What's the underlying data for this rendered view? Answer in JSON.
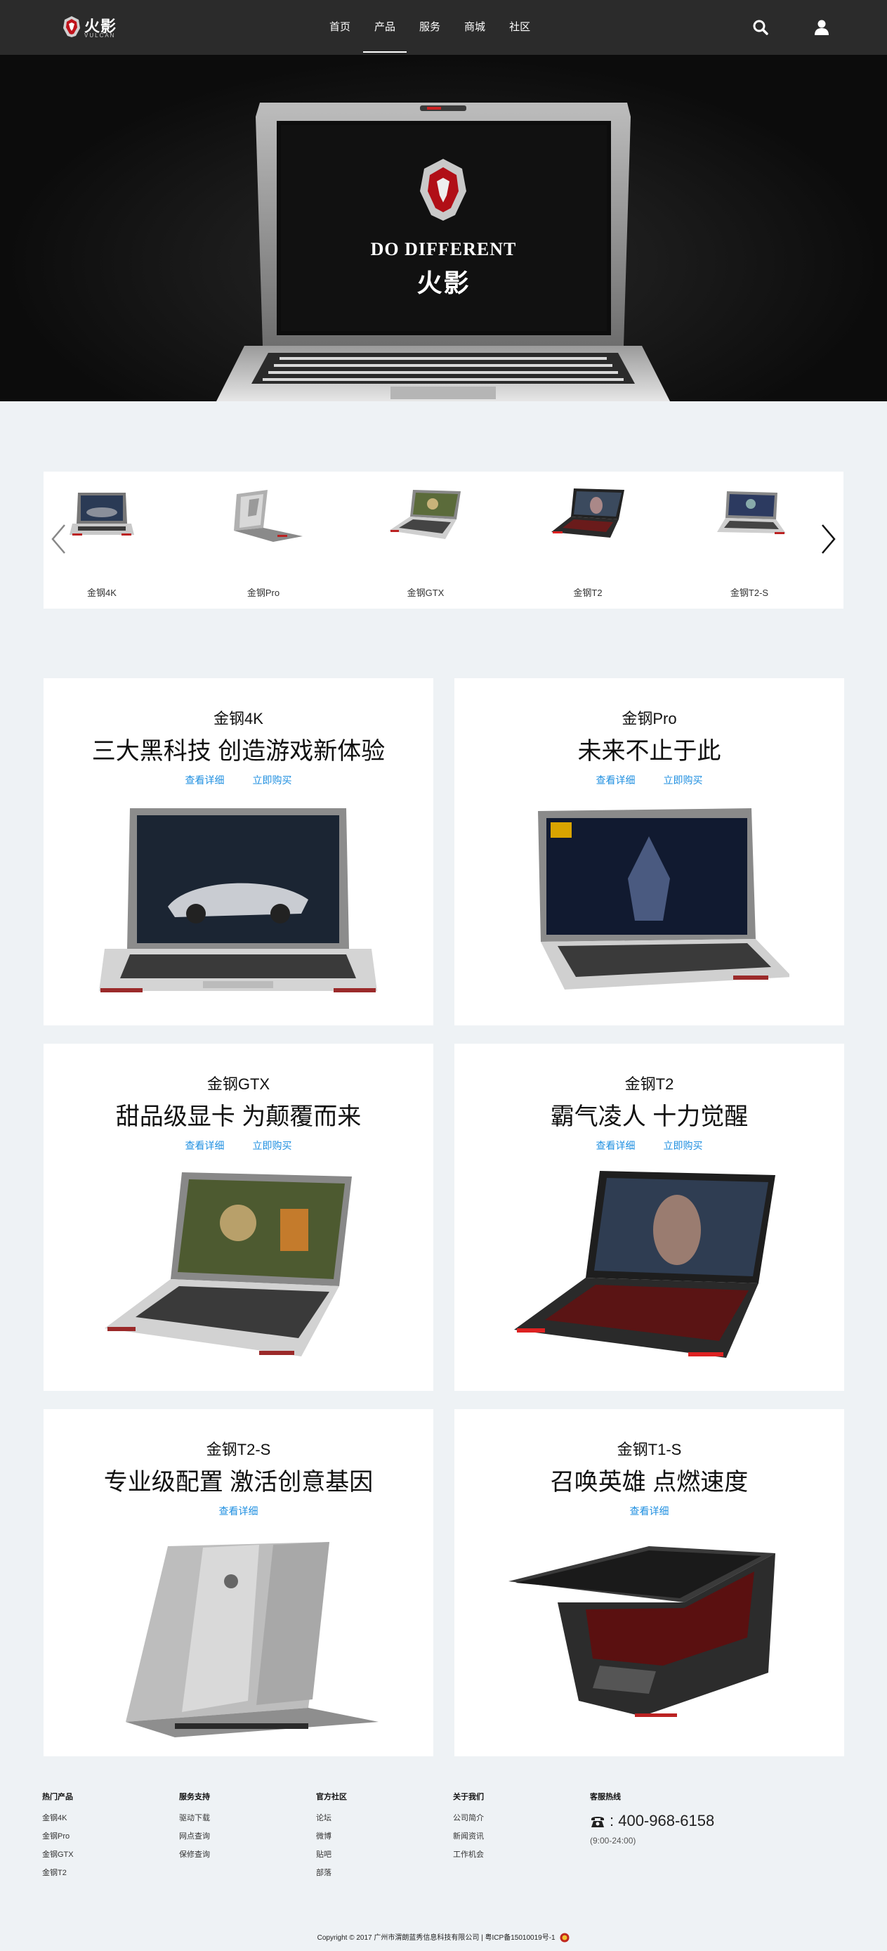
{
  "nav": {
    "logo_text": "火影",
    "logo_sub": "VULCAN",
    "items": [
      {
        "label": "首页",
        "active": false
      },
      {
        "label": "产品",
        "active": true
      },
      {
        "label": "服务",
        "active": false
      },
      {
        "label": "商城",
        "active": false
      },
      {
        "label": "社区",
        "active": false
      }
    ],
    "icons": [
      "search-icon",
      "user-icon"
    ]
  },
  "hero": {
    "slogan": "DO DIFFERENT",
    "brand": "火影"
  },
  "carousel": {
    "items": [
      {
        "label": "金钢4K"
      },
      {
        "label": "金钢Pro"
      },
      {
        "label": "金钢GTX"
      },
      {
        "label": "金钢T2"
      },
      {
        "label": "金钢T2-S"
      }
    ]
  },
  "products": [
    {
      "model": "金钢4K",
      "tagline": "三大黑科技 创造游戏新体验",
      "details": "查看详细",
      "buy": "立即购买"
    },
    {
      "model": "金钢Pro",
      "tagline": "未来不止于此",
      "details": "查看详细",
      "buy": "立即购买"
    },
    {
      "model": "金钢GTX",
      "tagline": "甜品级显卡 为颠覆而来",
      "details": "查看详细",
      "buy": "立即购买"
    },
    {
      "model": "金钢T2",
      "tagline": "霸气凌人 十力觉醒",
      "details": "查看详细",
      "buy": "立即购买"
    },
    {
      "model": "金钢T2-S",
      "tagline": "专业级配置 激活创意基因",
      "details": "查看详细"
    },
    {
      "model": "金钢T1-S",
      "tagline": "召唤英雄 点燃速度",
      "details": "查看详细"
    }
  ],
  "footer": {
    "columns": [
      {
        "title": "热门产品",
        "items": [
          "金钢4K",
          "金钢Pro",
          "金钢GTX",
          "金钢T2"
        ]
      },
      {
        "title": "服务支持",
        "items": [
          "驱动下载",
          "网点查询",
          "保修查询"
        ]
      },
      {
        "title": "官方社区",
        "items": [
          "论坛",
          "微博",
          "贴吧",
          "部落"
        ]
      },
      {
        "title": "关于我们",
        "items": [
          "公司简介",
          "新闻资讯",
          "工作机会"
        ]
      }
    ],
    "hotline_title": "客服热线",
    "hotline": ": 400-968-6158",
    "hours": "(9:00-24:00)",
    "copyright": "Copyright © 2017 广州市渭朗蓝秀信息科技有限公司 | 粤ICP备15010019号-1"
  }
}
